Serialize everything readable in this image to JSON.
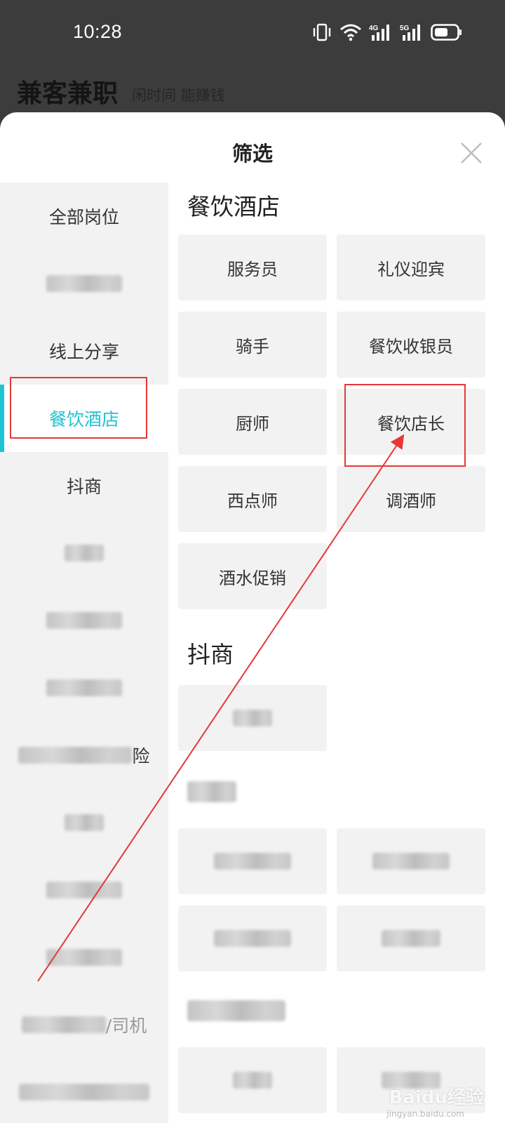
{
  "status_bar": {
    "time": "10:28",
    "network_1": "4G",
    "network_2": "5G",
    "icons": [
      "vibrate-icon",
      "wifi-icon",
      "signal-4g-icon",
      "signal-5g-icon",
      "battery-icon"
    ]
  },
  "app": {
    "title": "兼客兼职",
    "slogan": "闲时间 能赚钱"
  },
  "sheet": {
    "title": "筛选",
    "close_icon": "close-icon"
  },
  "left_nav": {
    "items": [
      {
        "label": "全部岗位"
      },
      {
        "label": ""
      },
      {
        "label": "线上分享"
      },
      {
        "label": "餐饮酒店",
        "active": true
      },
      {
        "label": "抖商"
      },
      {
        "label": ""
      },
      {
        "label": ""
      },
      {
        "label": ""
      },
      {
        "label": "险"
      },
      {
        "label": ""
      },
      {
        "label": ""
      },
      {
        "label": ""
      },
      {
        "label": "/司机"
      },
      {
        "label": ""
      }
    ]
  },
  "sections": [
    {
      "title": "餐饮酒店",
      "tags": [
        "服务员",
        "礼仪迎宾",
        "骑手",
        "餐饮收银员",
        "厨师",
        "餐饮店长",
        "西点师",
        "调酒师",
        "酒水促销"
      ]
    },
    {
      "title": "抖商",
      "tags": [
        ""
      ]
    },
    {
      "title": "",
      "tags": [
        "",
        "",
        "",
        ""
      ]
    },
    {
      "title": "",
      "tags": [
        "",
        ""
      ]
    }
  ],
  "annotation": {
    "color": "#e53935",
    "highlighted_nav": "餐饮酒店",
    "highlighted_tag": "餐饮店长"
  },
  "theme": {
    "accent": "#1ec3d4"
  },
  "watermark": {
    "brand": "Baidu经验",
    "url": "jingyan.baidu.com"
  }
}
